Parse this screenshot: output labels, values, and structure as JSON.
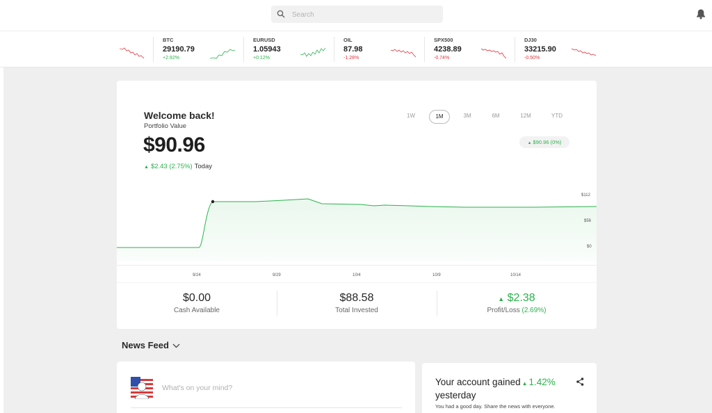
{
  "search": {
    "placeholder": "Search"
  },
  "ticker": [
    {
      "symbol": "BTC",
      "price": "29190.79",
      "change": "+2.92%",
      "dir": "up"
    },
    {
      "symbol": "EURUSD",
      "price": "1.05943",
      "change": "+0.12%",
      "dir": "up"
    },
    {
      "symbol": "OIL",
      "price": "87.98",
      "change": "-1.28%",
      "dir": "down"
    },
    {
      "symbol": "SPX500",
      "price": "4238.89",
      "change": "-0.74%",
      "dir": "down"
    },
    {
      "symbol": "DJ30",
      "price": "33215.90",
      "change": "-0.50%",
      "dir": "down"
    }
  ],
  "portfolio": {
    "welcome": "Welcome back!",
    "label": "Portfolio Value",
    "value": "$90.96",
    "today_change": "$2.43 (2.75%)",
    "today_label": "Today",
    "period_change": "$90.96 (0%)",
    "periods": [
      "1W",
      "1M",
      "3M",
      "6M",
      "12M",
      "YTD"
    ],
    "active_period": "1M"
  },
  "chart": {
    "y_labels": [
      "$112",
      "$56",
      "$0"
    ],
    "x_labels": [
      "9/24",
      "9/29",
      "10/4",
      "10/9",
      "10/14"
    ]
  },
  "summary": {
    "cash_value": "$0.00",
    "cash_label": "Cash Available",
    "invested_value": "$88.58",
    "invested_label": "Total Invested",
    "pl_value": "$2.38",
    "pl_label": "Profit/Loss",
    "pl_percent": "(2.69%)"
  },
  "news": {
    "title": "News Feed",
    "post_placeholder": "What's on your mind?"
  },
  "gain_card": {
    "title_prefix": "Your account gained",
    "percent": "1.42%",
    "title_suffix": "yesterday",
    "subtitle": "You had a good day. Share the news with everyone."
  },
  "colors": {
    "up": "#2bb24c",
    "down": "#e5343d"
  }
}
